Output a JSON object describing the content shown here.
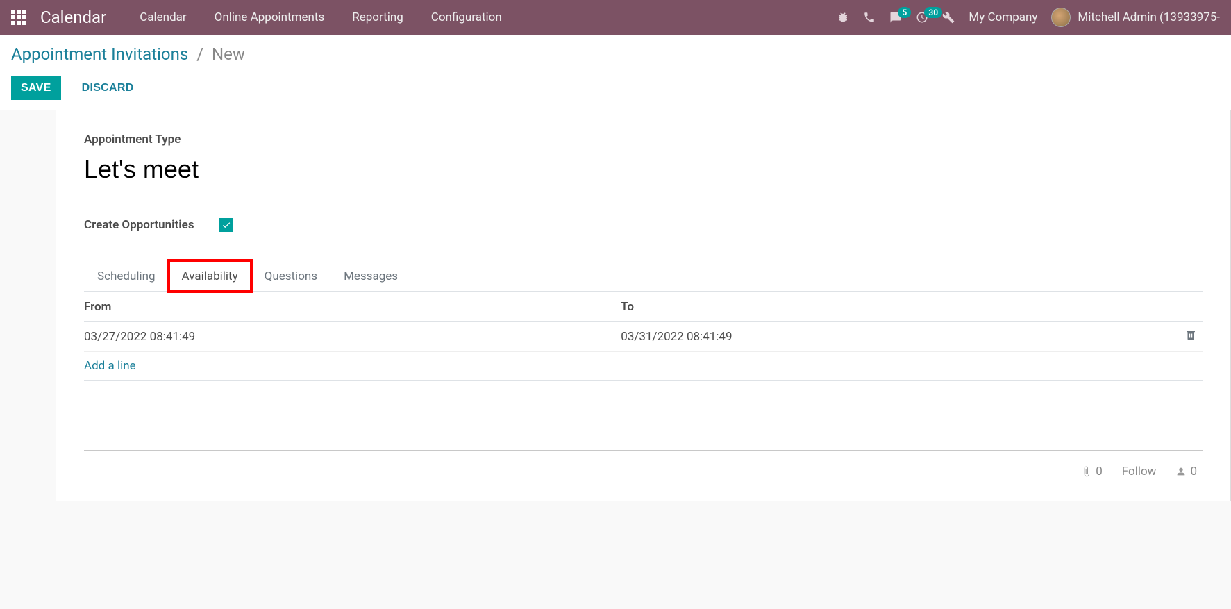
{
  "header": {
    "app_title": "Calendar",
    "nav": [
      "Calendar",
      "Online Appointments",
      "Reporting",
      "Configuration"
    ],
    "msg_badge": "5",
    "activity_badge": "30",
    "company": "My Company",
    "user": "Mitchell Admin (13933975-"
  },
  "breadcrumb": {
    "parent": "Appointment Invitations",
    "current": "New"
  },
  "buttons": {
    "save": "SAVE",
    "discard": "DISCARD"
  },
  "form": {
    "type_label": "Appointment Type",
    "type_value": "Let's meet",
    "create_opp_label": "Create Opportunities",
    "create_opp_checked": true
  },
  "tabs": [
    "Scheduling",
    "Availability",
    "Questions",
    "Messages"
  ],
  "active_tab": 1,
  "table": {
    "headers": {
      "from": "From",
      "to": "To"
    },
    "rows": [
      {
        "from": "03/27/2022 08:41:49",
        "to": "03/31/2022 08:41:49"
      }
    ],
    "add_line": "Add a line"
  },
  "chatter": {
    "attach_count": "0",
    "follow": "Follow",
    "followers": "0"
  }
}
